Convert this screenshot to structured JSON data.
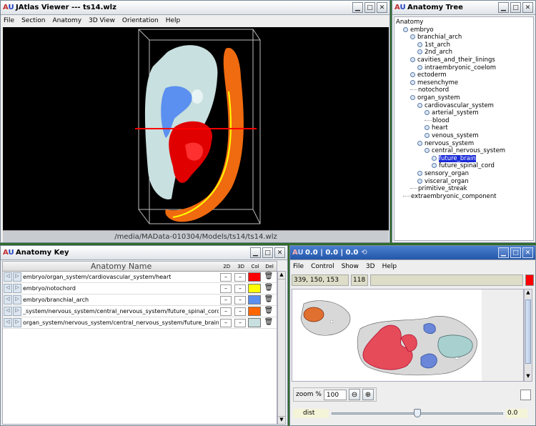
{
  "viewer": {
    "title": "JAtlas Viewer --- ts14.wlz",
    "menu": [
      "File",
      "Section",
      "Anatomy",
      "3D View",
      "Orientation",
      "Help"
    ],
    "status": "/media/MAData-010304/Models/ts14/ts14.wlz",
    "section_line_color": "#ff0000"
  },
  "tree": {
    "title": "Anatomy Tree",
    "nodes": [
      {
        "label": "Anatomy",
        "depth": 0,
        "toggle": false
      },
      {
        "label": "embryo",
        "depth": 1,
        "toggle": true
      },
      {
        "label": "branchial_arch",
        "depth": 2,
        "toggle": true
      },
      {
        "label": "1st_arch",
        "depth": 3,
        "toggle": true
      },
      {
        "label": "2nd_arch",
        "depth": 3,
        "toggle": true
      },
      {
        "label": "cavities_and_their_linings",
        "depth": 2,
        "toggle": true
      },
      {
        "label": "intraembryonic_coelom",
        "depth": 3,
        "toggle": true
      },
      {
        "label": "ectoderm",
        "depth": 2,
        "toggle": true
      },
      {
        "label": "mesenchyme",
        "depth": 2,
        "toggle": true
      },
      {
        "label": "notochord",
        "depth": 2,
        "toggle": false
      },
      {
        "label": "organ_system",
        "depth": 2,
        "toggle": true
      },
      {
        "label": "cardiovascular_system",
        "depth": 3,
        "toggle": true
      },
      {
        "label": "arterial_system",
        "depth": 4,
        "toggle": true
      },
      {
        "label": "blood",
        "depth": 4,
        "toggle": false
      },
      {
        "label": "heart",
        "depth": 4,
        "toggle": true
      },
      {
        "label": "venous_system",
        "depth": 4,
        "toggle": true
      },
      {
        "label": "nervous_system",
        "depth": 3,
        "toggle": true
      },
      {
        "label": "central_nervous_system",
        "depth": 4,
        "toggle": true
      },
      {
        "label": "future_brain",
        "depth": 5,
        "toggle": true,
        "selected": true
      },
      {
        "label": "future_spinal_cord",
        "depth": 5,
        "toggle": true
      },
      {
        "label": "sensory_organ",
        "depth": 3,
        "toggle": true
      },
      {
        "label": "visceral_organ",
        "depth": 3,
        "toggle": true
      },
      {
        "label": "primitive_streak",
        "depth": 2,
        "toggle": false
      },
      {
        "label": "extraembryonic_component",
        "depth": 1,
        "toggle": false
      }
    ]
  },
  "key": {
    "title": "Anatomy Key",
    "columns": {
      "name": "Anatomy Name",
      "c2d": "2D",
      "c3d": "3D",
      "col": "Col",
      "del": "Del"
    },
    "rows": [
      {
        "name": "embryo/organ_system/cardiovascular_system/heart",
        "color": "#ff0000"
      },
      {
        "name": "embryo/notochord",
        "color": "#ffff00"
      },
      {
        "name": "embryo/branchial_arch",
        "color": "#5b8ff0"
      },
      {
        "name": "_system/nervous_system/central_nervous_system/future_spinal_cord",
        "color": "#ff6600"
      },
      {
        "name": "organ_system/nervous_system/central_nervous_system/future_brain",
        "color": "#c8e0df"
      }
    ]
  },
  "section": {
    "title": "0.0 | 0.0 | 0.0",
    "menu": [
      "File",
      "Control",
      "Show",
      "3D",
      "Help"
    ],
    "coords": "339, 150, 153",
    "value": "118",
    "indicator_color": "#ff0000",
    "zoom_label": "zoom %",
    "zoom_value": "100",
    "dist_label": "dist",
    "dist_value": "0.0",
    "dist_fraction": 0.5
  }
}
